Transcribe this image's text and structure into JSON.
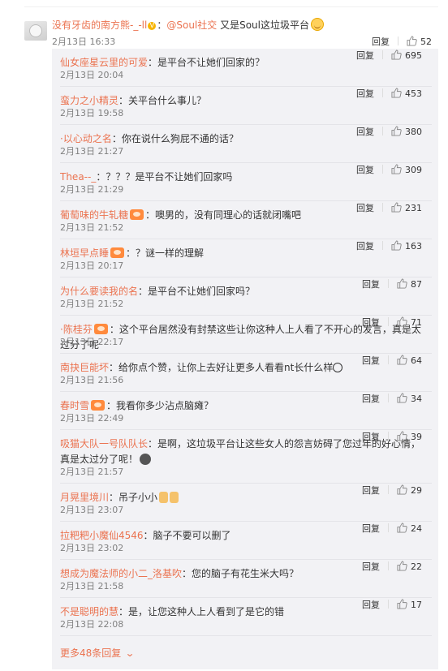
{
  "main_comment": {
    "user": "没有牙齿的南方熊-_-ll",
    "colon": "：",
    "mention": "@Soul社交",
    "text": " 又是Soul这垃圾平台",
    "time": "2月13日 16:33",
    "reply_label": "回复",
    "likes": "52"
  },
  "replies": [
    {
      "user": "仙女座星云里的可爱",
      "text": "：是平台不让她们回家的？",
      "time": "2月13日 20:04",
      "reply_label": "回复",
      "likes": "695"
    },
    {
      "user": "蛮力之小精灵",
      "text": "：关平台什么事儿？",
      "time": "2月13日 19:58",
      "reply_label": "回复",
      "likes": "453"
    },
    {
      "user": "·以心动之名",
      "text": "：你在说什么狗屁不通的话？",
      "time": "2月13日 21:27",
      "reply_label": "回复",
      "likes": "380"
    },
    {
      "user": "Thea--_",
      "text": "：？？？是平台不让她们回家吗",
      "time": "2月13日 21:29",
      "reply_label": "回复",
      "likes": "309"
    },
    {
      "user": "葡萄味的牛轧糖",
      "text": "：噢男的，没有同理心的话就闭嘴吧",
      "time": "2月13日 21:52",
      "reply_label": "回复",
      "likes": "231"
    },
    {
      "user": "林垣早点睡",
      "text": "：？谜一样的理解",
      "time": "2月13日 20:17",
      "reply_label": "回复",
      "likes": "163"
    },
    {
      "user": "为什么要读我的名",
      "text": "：是平台不让她们回家吗？",
      "time": "2月13日 21:52",
      "reply_label": "回复",
      "likes": "87"
    },
    {
      "user": "·陈桂芬",
      "text": "：这个平台居然没有封禁这些让你这种人上人看了不开心的发言，真是太过分了呢",
      "time": "2月13日 22:17",
      "reply_label": "回复",
      "likes": "71"
    },
    {
      "user": "南抉巨能坏",
      "text": "：给你点个赞，让你上去好让更多人看看nt长什么样",
      "time": "2月13日 21:56",
      "reply_label": "回复",
      "likes": "64"
    },
    {
      "user": "春时雪",
      "text": "：我看你多少沾点脑瘫？",
      "time": "2月13日 22:49",
      "reply_label": "回复",
      "likes": "34"
    },
    {
      "user": "吸猫大队一号队队长",
      "text": "：是啊，这垃圾平台让这些女人的怨言妨碍了您过年的好心情，真是太过分了呢！",
      "time": "2月13日 21:57",
      "reply_label": "回复",
      "likes": "39"
    },
    {
      "user": "月晃里境川",
      "text": "：吊子小小",
      "time": "2月13日 23:07",
      "reply_label": "回复",
      "likes": "29"
    },
    {
      "user": "拉粑粑小魔仙4546",
      "text": "：脑子不要可以删了",
      "time": "2月13日 23:02",
      "reply_label": "回复",
      "likes": "24"
    },
    {
      "user": "想成为魔法师的小二_洛基吹",
      "text": "：您的脑子有花生米大吗？",
      "time": "2月13日 21:58",
      "reply_label": "回复",
      "likes": "22"
    },
    {
      "user": "不是聪明的慧",
      "text": "：是，让您这种人上人看到了是它的错",
      "time": "2月13日 22:08",
      "reply_label": "回复",
      "likes": "17"
    }
  ],
  "more_link": "更多48条回复",
  "colors": {
    "username": "#eb7350",
    "reply_bg": "#f2f2f5",
    "meta": "#808080"
  },
  "icons": [
    "like-icon",
    "chevron-down-icon",
    "avatar",
    "vip-badge-icon",
    "emoji-icon"
  ]
}
